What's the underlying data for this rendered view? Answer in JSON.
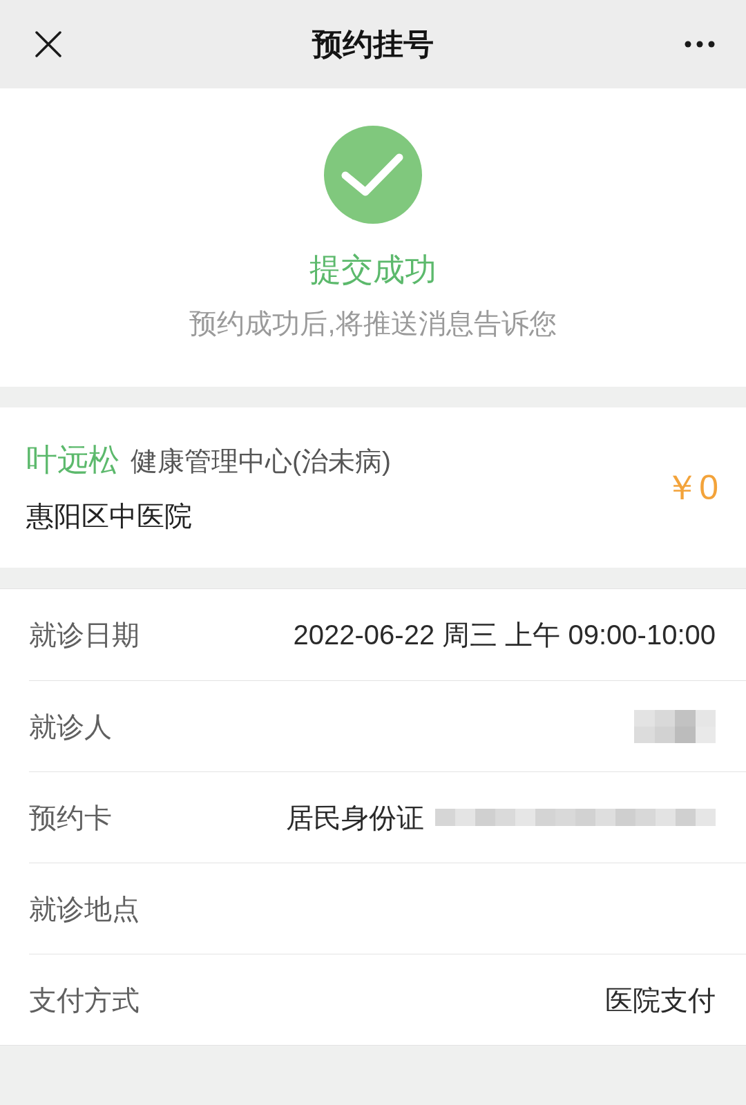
{
  "nav": {
    "title": "预约挂号"
  },
  "result": {
    "success": true,
    "title": "提交成功",
    "message": "预约成功后,将推送消息告诉您"
  },
  "appointment": {
    "doctor": "叶远松",
    "department": "健康管理中心(治未病)",
    "hospital": "惠阳区中医院",
    "fee": "￥0"
  },
  "details": [
    {
      "label": "就诊日期",
      "value": "2022-06-22 周三 上午 09:00-10:00",
      "redacted": false
    },
    {
      "label": "就诊人",
      "redacted": true
    },
    {
      "label": "预约卡",
      "value": "居民身份证",
      "redacted": true
    },
    {
      "label": "就诊地点",
      "redacted": false
    },
    {
      "label": "支付方式",
      "value": "医院支付",
      "redacted": false
    }
  ]
}
